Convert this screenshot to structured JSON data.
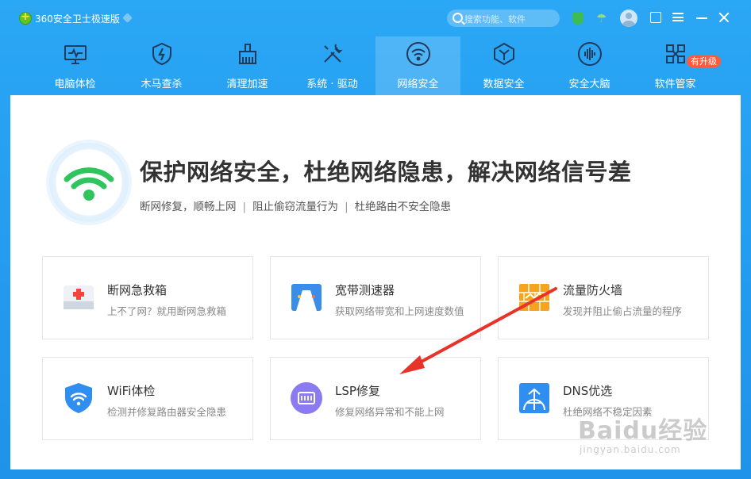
{
  "app": {
    "title": "360安全卫士极速版"
  },
  "search": {
    "placeholder": "搜索功能、软件"
  },
  "nav": {
    "items": [
      {
        "label": "电脑体检",
        "icon": "monitor-icon"
      },
      {
        "label": "木马查杀",
        "icon": "shield-bolt-icon"
      },
      {
        "label": "清理加速",
        "icon": "broom-icon"
      },
      {
        "label": "系统 · 驱动",
        "icon": "wrench-screwdriver-icon"
      },
      {
        "label": "网络安全",
        "icon": "wifi-icon",
        "active": true
      },
      {
        "label": "数据安全",
        "icon": "cube-icon"
      },
      {
        "label": "安全大脑",
        "icon": "brain-icon"
      },
      {
        "label": "软件管家",
        "icon": "apps-icon",
        "badge": "有升级"
      }
    ]
  },
  "hero": {
    "title": "保护网络安全，杜绝网络隐患，解决网络信号差",
    "subtitle_parts": [
      "断网修复，顺畅上网",
      "阻止偷窃流量行为",
      "杜绝路由不安全隐患"
    ],
    "separator": "|"
  },
  "cards": [
    {
      "title": "断网急救箱",
      "desc": "上不了网？就用断网急救箱",
      "icon": "first-aid-kit-icon"
    },
    {
      "title": "宽带测速器",
      "desc": "获取网络带宽和上网速度数值",
      "icon": "speedometer-icon"
    },
    {
      "title": "流量防火墙",
      "desc": "发现并阻止偷占流量的程序",
      "icon": "firewall-icon"
    },
    {
      "title": "WiFi体检",
      "desc": "检测并修复路由器安全隐患",
      "icon": "wifi-shield-icon"
    },
    {
      "title": "LSP修复",
      "desc": "修复网络异常和不能上网",
      "icon": "lsp-repair-icon"
    },
    {
      "title": "DNS优选",
      "desc": "杜绝网络不稳定因素",
      "icon": "dns-globe-icon"
    }
  ],
  "watermark": {
    "logo": "Baidu经验",
    "url": "jingyan.baidu.com"
  },
  "colors": {
    "accent": "#1f92ea",
    "active_tab": "#4fb6f5",
    "badge": "#ff5a3c",
    "arrow": "#e8332a"
  }
}
